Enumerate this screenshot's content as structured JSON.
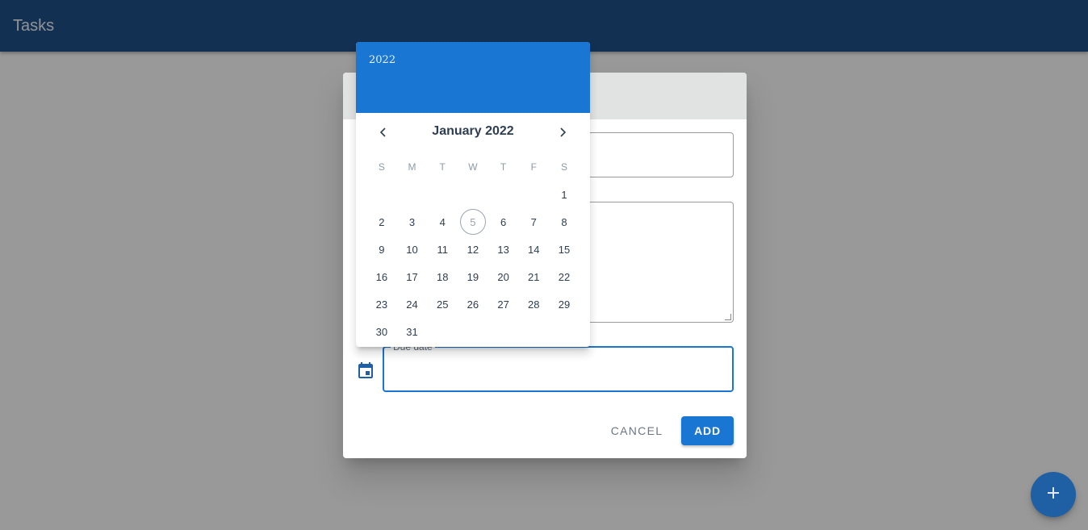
{
  "app_bar": {
    "title": "Tasks"
  },
  "dialog": {
    "fields": {
      "due_date_label": "Due date"
    },
    "buttons": {
      "cancel": "CANCEL",
      "add": "ADD"
    }
  },
  "date_picker": {
    "year": "2022",
    "month_label": "January 2022",
    "weekdays": [
      "S",
      "M",
      "T",
      "W",
      "T",
      "F",
      "S"
    ],
    "weeks": [
      [
        "",
        "",
        "",
        "",
        "",
        "",
        "1"
      ],
      [
        "2",
        "3",
        "4",
        "5",
        "6",
        "7",
        "8"
      ],
      [
        "9",
        "10",
        "11",
        "12",
        "13",
        "14",
        "15"
      ],
      [
        "16",
        "17",
        "18",
        "19",
        "20",
        "21",
        "22"
      ],
      [
        "23",
        "24",
        "25",
        "26",
        "27",
        "28",
        "29"
      ],
      [
        "30",
        "31",
        "",
        "",
        "",
        "",
        ""
      ]
    ],
    "today": "5"
  },
  "icons": {
    "calendar": "calendar-icon",
    "prev": "chevron-left-icon",
    "next": "chevron-right-icon",
    "fab": "plus-icon"
  },
  "colors": {
    "primary": "#1976d2",
    "app_bar": "#1f5fa4",
    "text": "#2d3e50"
  }
}
